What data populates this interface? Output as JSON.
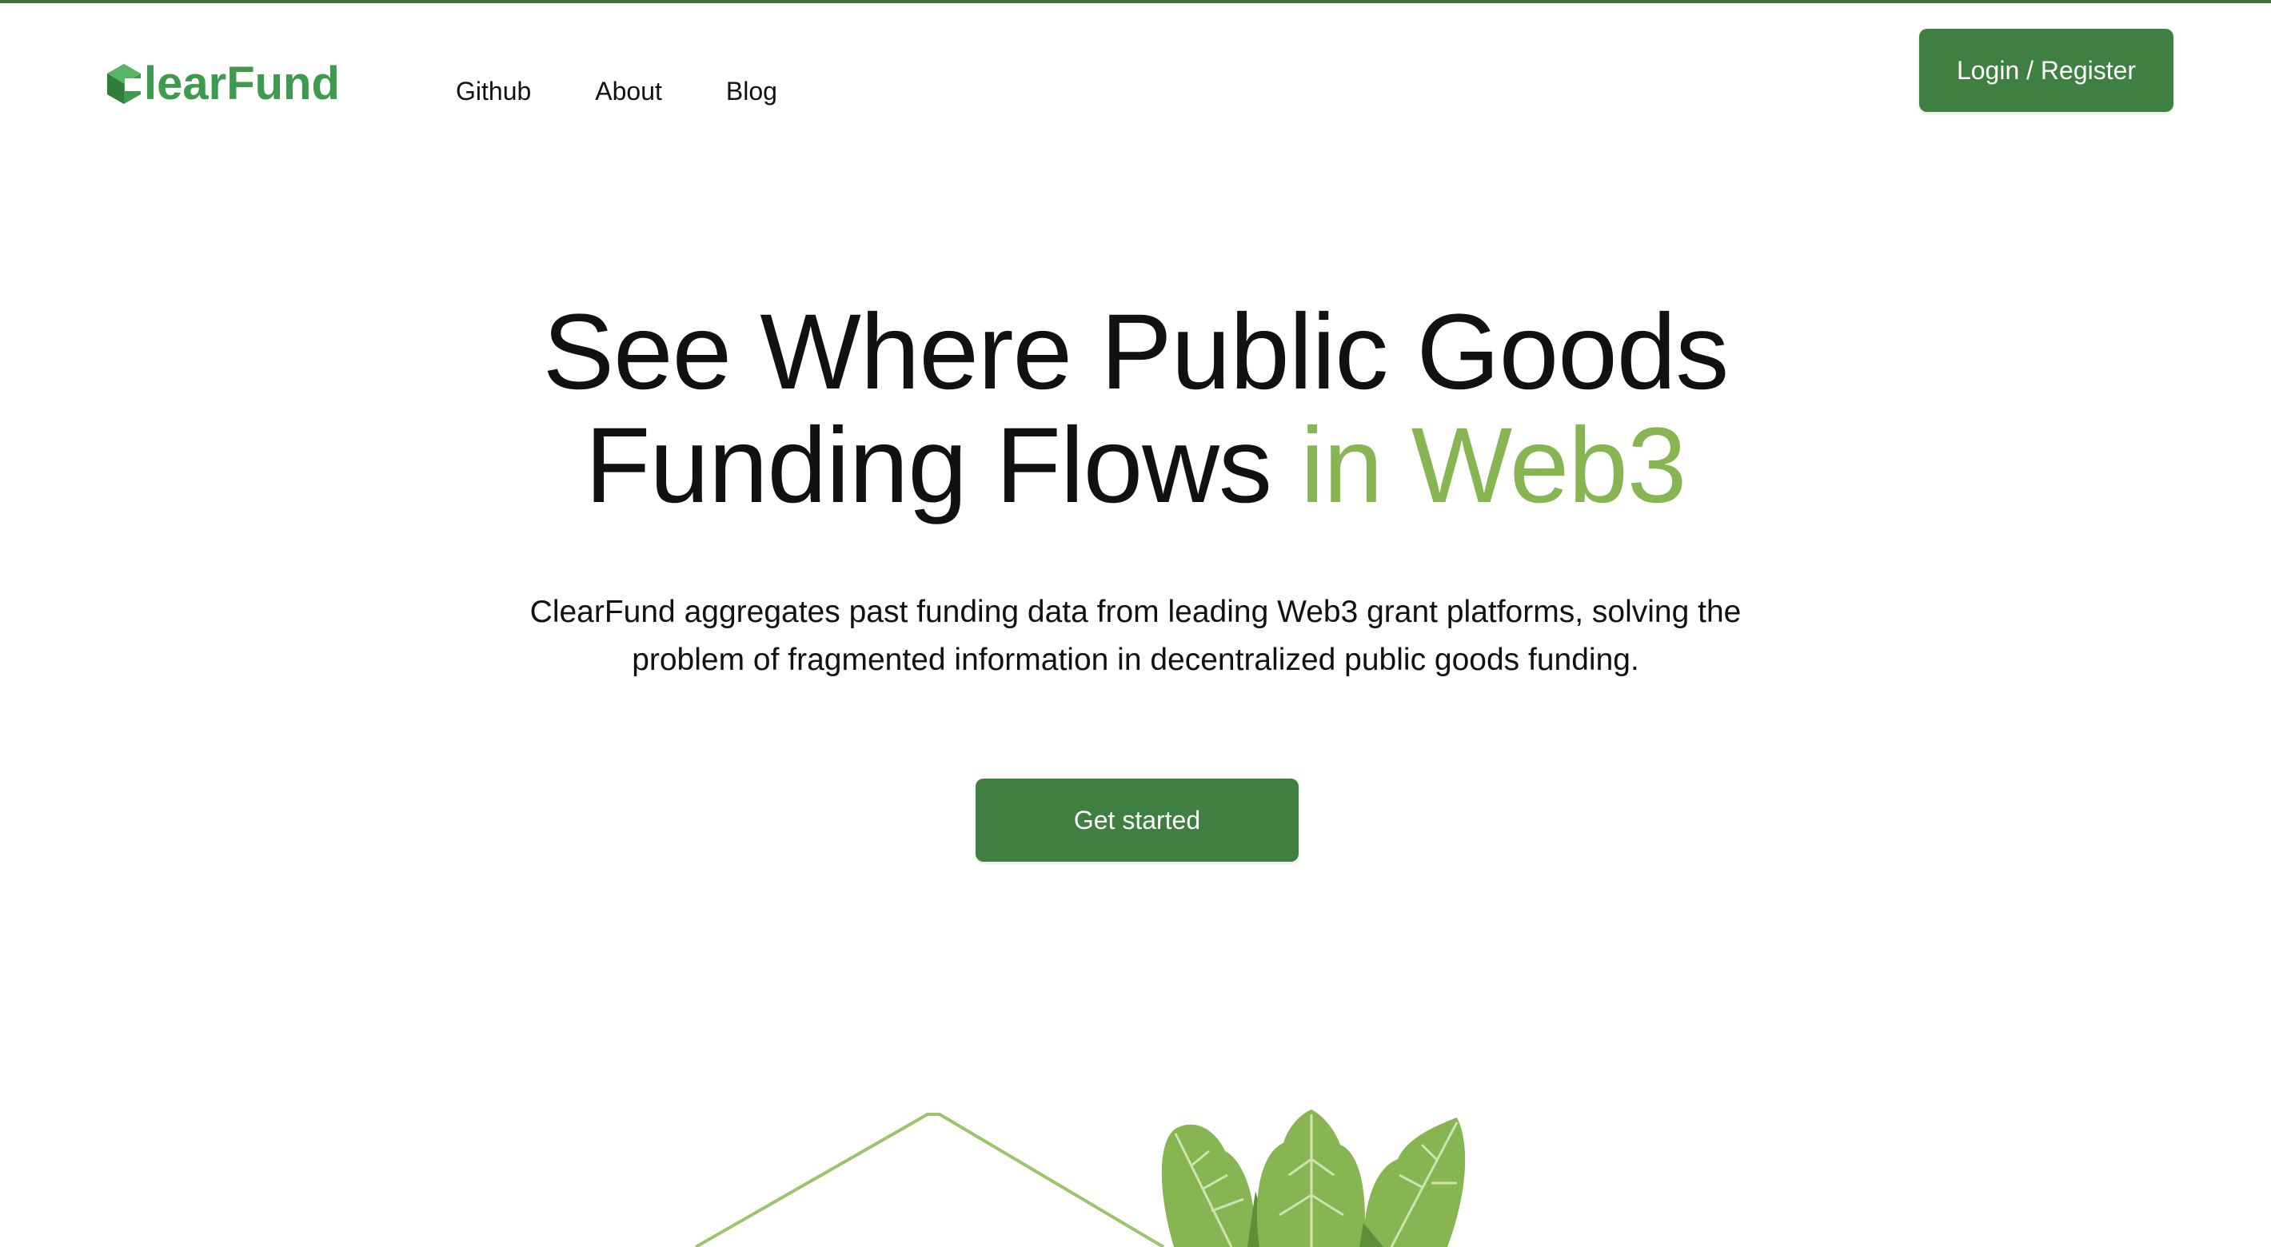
{
  "brand": {
    "name": "ClearFund",
    "primary_color": "#3f7f41",
    "logo_color": "#3e9a4c",
    "accent_color": "#86b552"
  },
  "header": {
    "logo_text": "learFund",
    "logo_icon": "clearfund-hexagon-logo-icon",
    "nav": [
      {
        "label": "Github"
      },
      {
        "label": "About"
      },
      {
        "label": "Blog"
      }
    ],
    "login_label": "Login / Register"
  },
  "hero": {
    "title_line1": "See Where Public Goods",
    "title_line2_prefix": "Funding Flows",
    "title_line2_accent": "in Web3",
    "subtitle_line1": "ClearFund aggregates past funding data from leading Web3 grant platforms, solving the",
    "subtitle_line2": "problem of fragmented information in decentralized public goods funding.",
    "cta_label": "Get started"
  },
  "illustration": {
    "elements": [
      "outline-pyramid-shape",
      "green-leaves-plant-icon"
    ]
  }
}
